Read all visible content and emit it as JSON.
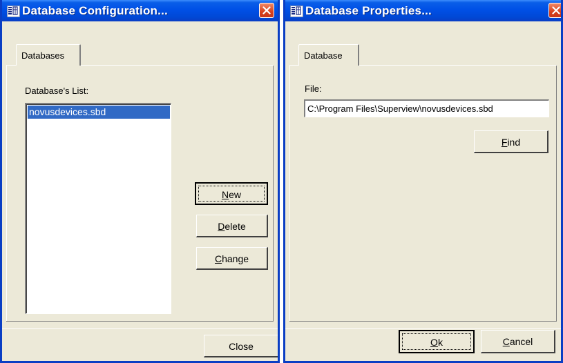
{
  "config_window": {
    "title": "Database Configuration...",
    "tab": "Databases",
    "list_label": "Database's List:",
    "list_items": [
      "novusdevices.sbd"
    ],
    "buttons": {
      "new": {
        "pre": "",
        "key": "N",
        "post": "ew"
      },
      "delete": {
        "pre": "",
        "key": "D",
        "post": "elete"
      },
      "change": {
        "pre": "",
        "key": "C",
        "post": "hange"
      },
      "close": "Close"
    }
  },
  "properties_window": {
    "title": "Database Properties...",
    "tab": "Database",
    "file_label": "File:",
    "file_value": "C:\\Program Files\\Superview\\novusdevices.sbd",
    "buttons": {
      "find": {
        "pre": "",
        "key": "F",
        "post": "ind"
      },
      "ok": {
        "pre": "",
        "key": "O",
        "post": "k"
      },
      "cancel": {
        "pre": "",
        "key": "C",
        "post": "ancel"
      }
    }
  },
  "icons": {
    "app": "database-app-icon",
    "close": "close-icon"
  },
  "colors": {
    "titlebar": "#0050e6",
    "selection": "#316ac5",
    "close_button": "#d8401c",
    "dialog_face": "#ece9d8"
  }
}
